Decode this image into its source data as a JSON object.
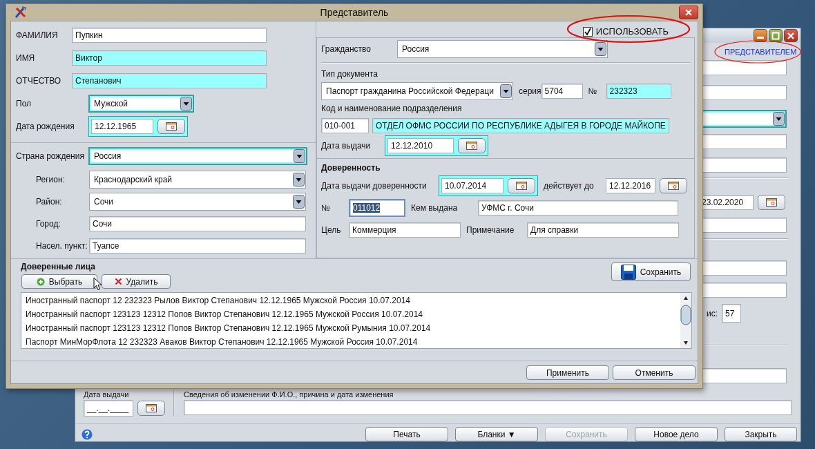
{
  "app_window": {
    "link": "ПРЕДСТАВИТЕЛЕМ",
    "expiry_date": "23.02.2020",
    "count_label": "ис:",
    "count_value": "57",
    "issue_date_label": "Дата выдачи",
    "issue_date_value": "__.__.____",
    "name_change_label": "Сведения об изменении Ф.И.О., причина и дата изменения",
    "buttons": [
      {
        "label": "Печать",
        "disabled": false
      },
      {
        "label": "Бланки ▼",
        "disabled": false
      },
      {
        "label": "Сохранить",
        "disabled": true
      },
      {
        "label": "Новое дело",
        "disabled": false
      },
      {
        "label": "Закрыть",
        "disabled": false
      }
    ]
  },
  "dialog": {
    "title": "Представитель",
    "use_checkbox": {
      "label": "ИСПОЛЬЗОВАТЬ",
      "checked": true
    },
    "person": [
      {
        "label": "ФАМИЛИЯ",
        "value": "Пупкин",
        "kind": "text",
        "required": false
      },
      {
        "label": "ИМЯ",
        "value": "Виктор",
        "kind": "text",
        "required": true
      },
      {
        "label": "ОТЧЕСТВО",
        "value": "Степанович",
        "kind": "text",
        "required": true
      },
      {
        "label": "Пол",
        "value": "Мужской",
        "kind": "combo",
        "required": true
      },
      {
        "label": "Дата рождения",
        "value": "12.12.1965",
        "kind": "date",
        "required": true
      }
    ],
    "birthplace": [
      {
        "label": "Страна рождения",
        "value": "Россия",
        "kind": "combo",
        "required": true
      },
      {
        "label": "Регион:",
        "value": "Краснодарский край",
        "kind": "combo",
        "required": false
      },
      {
        "label": "Район:",
        "value": "Сочи",
        "kind": "combo",
        "required": false
      },
      {
        "label": "Город:",
        "value": "Сочи",
        "kind": "text",
        "required": false
      },
      {
        "label": "Насел. пункт:",
        "value": "Туапсе",
        "kind": "text",
        "required": false
      }
    ],
    "citizenship": {
      "label": "Гражданство",
      "field": {
        "value": "Россия",
        "kind": "combo",
        "required": false
      }
    },
    "document": {
      "type_label": "Тип документа",
      "type": {
        "value": "Паспорт гражданина Российской Федераци",
        "kind": "combo",
        "required": false
      },
      "series_label": "серия",
      "series": {
        "value": "5704",
        "kind": "text",
        "required": false
      },
      "number_label": "№",
      "number": {
        "value": "232323",
        "kind": "text",
        "required": true
      },
      "unit_label": "Код и наименование подразделения",
      "unit_code": {
        "value": "010-001",
        "kind": "text",
        "required": false
      },
      "unit_name": {
        "value": "ОТДЕЛ ОФМС РОССИИ ПО РЕСПУБЛИКЕ АДЫГЕЯ В ГОРОДЕ МАЙКОПЕ",
        "kind": "text",
        "required": true
      },
      "issue_label": "Дата выдачи",
      "issue_date": {
        "value": "12.12.2010",
        "kind": "date",
        "required": true
      }
    },
    "proxy": {
      "title": "Доверенность",
      "issue_label": "Дата выдачи доверенности",
      "issue_date": {
        "value": "10.07.2014",
        "kind": "date",
        "required": true
      },
      "valid_label": "действует до",
      "valid_date": {
        "value": "12.12.2016",
        "kind": "date",
        "required": false
      },
      "number_label": "№",
      "number": {
        "value": "011012",
        "kind": "text",
        "required": false,
        "text_selected": true
      },
      "issued_by_label": "Кем выдана",
      "issued_by": {
        "value": "УФМС г. Сочи",
        "kind": "text",
        "required": false
      },
      "purpose_label": "Цель",
      "purpose": {
        "value": "Коммерция",
        "kind": "text",
        "required": false
      },
      "note_label": "Примечание",
      "note": {
        "value": "Для справки",
        "kind": "text",
        "required": false
      }
    },
    "trusted": {
      "title": "Доверенные лица",
      "buttons": [
        {
          "label": "Выбрать",
          "kind": "add"
        },
        {
          "label": "Удалить",
          "kind": "delete"
        }
      ],
      "save": "Сохранить",
      "rows": [
        "Иностранный паспорт 12 232323 Рылов Виктор Степанович 12.12.1965 Мужской Россия 10.07.2014",
        "Иностранный паспорт 123123 12312 Попов Виктор Степанович 12.12.1965 Мужской Россия 10.07.2014",
        "Иностранный паспорт 123123 12312 Попов Виктор Степанович 12.12.1965 Мужской Румыния 10.07.2014",
        "Паспорт МинМорФлота 12 232323 Аваков Виктор Степанович 12.12.1965 Мужской Россия 10.07.2014"
      ]
    },
    "footer_buttons": [
      "Применить",
      "Отменить"
    ]
  }
}
